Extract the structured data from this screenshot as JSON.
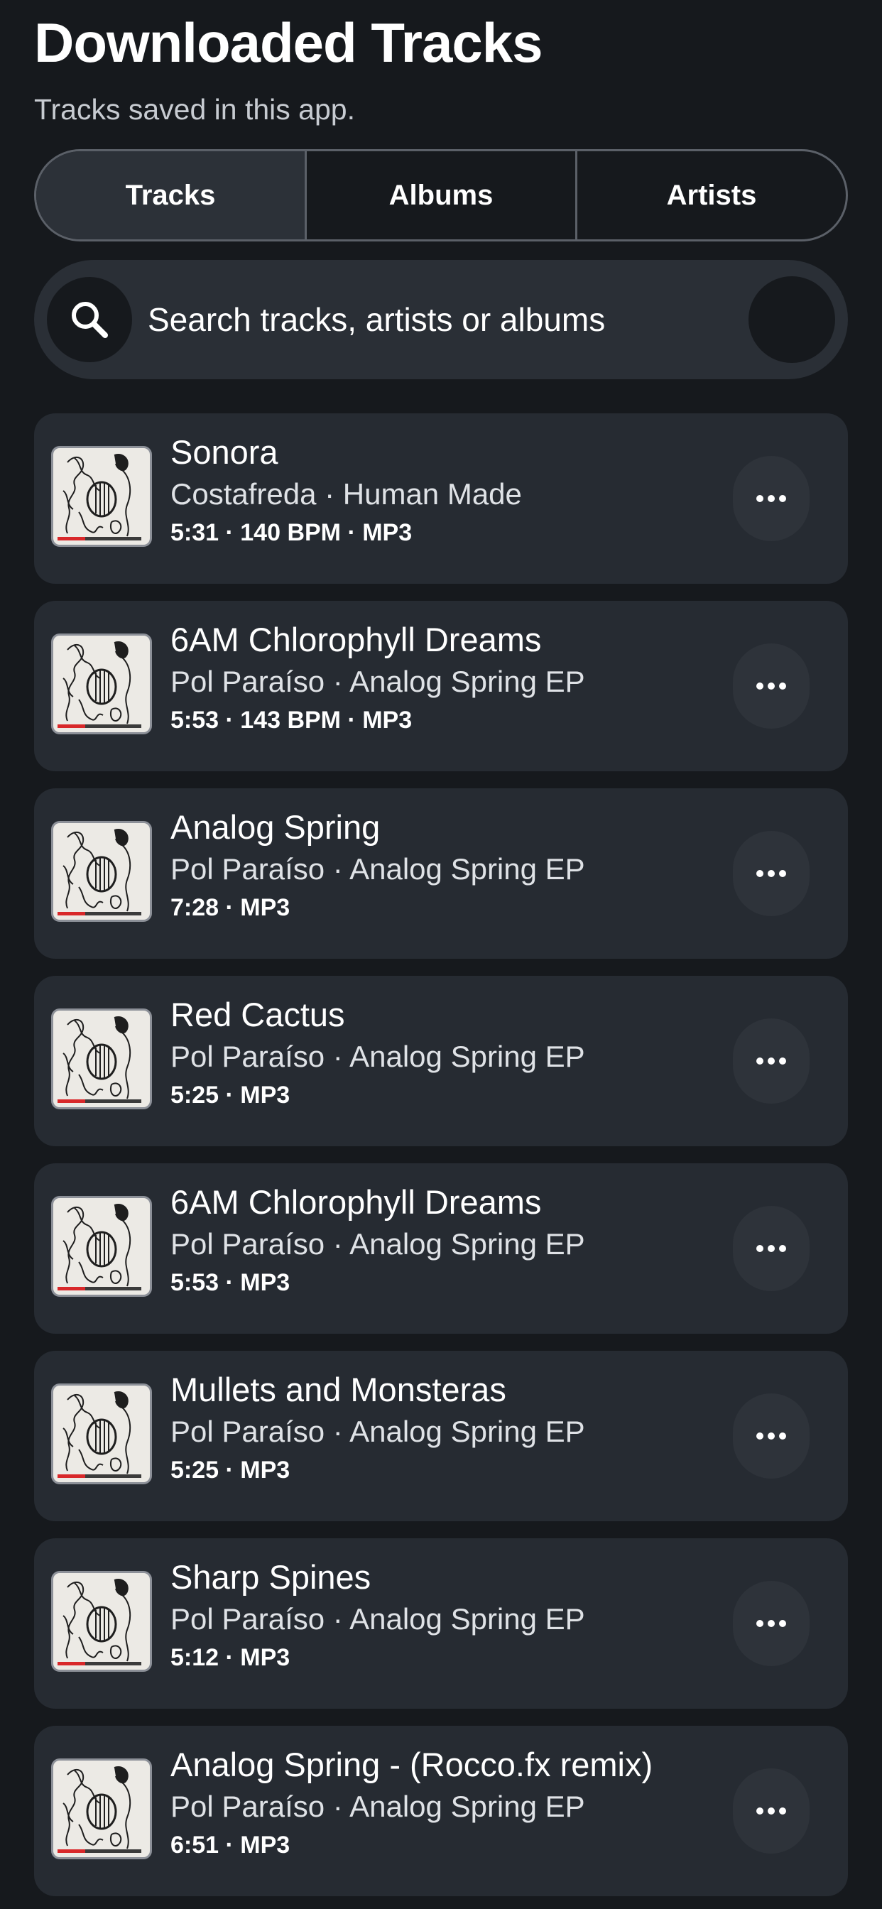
{
  "header": {
    "title": "Downloaded Tracks",
    "subtitle": "Tracks saved in this app."
  },
  "tabs": [
    {
      "label": "Tracks",
      "active": true
    },
    {
      "label": "Albums",
      "active": false
    },
    {
      "label": "Artists",
      "active": false
    }
  ],
  "search": {
    "placeholder": "Search tracks, artists or albums",
    "value": ""
  },
  "tracks": [
    {
      "title": "Sonora",
      "subtitle": "Costafreda · Human Made",
      "meta": "5:31 · 140 BPM · MP3",
      "progress": 0.33
    },
    {
      "title": "6AM Chlorophyll Dreams",
      "subtitle": "Pol Paraíso · Analog Spring EP",
      "meta": "5:53 · 143 BPM · MP3",
      "progress": 0.33
    },
    {
      "title": "Analog Spring",
      "subtitle": "Pol Paraíso · Analog Spring EP",
      "meta": "7:28 · MP3",
      "progress": 0.33
    },
    {
      "title": "Red Cactus",
      "subtitle": "Pol Paraíso · Analog Spring EP",
      "meta": "5:25 · MP3",
      "progress": 0.33
    },
    {
      "title": "6AM Chlorophyll Dreams",
      "subtitle": "Pol Paraíso · Analog Spring EP",
      "meta": "5:53 · MP3",
      "progress": 0.33
    },
    {
      "title": "Mullets and Monsteras",
      "subtitle": "Pol Paraíso · Analog Spring EP",
      "meta": "5:25 · MP3",
      "progress": 0.33
    },
    {
      "title": "Sharp Spines",
      "subtitle": "Pol Paraíso · Analog Spring EP",
      "meta": "5:12 · MP3",
      "progress": 0.33
    },
    {
      "title": "Analog Spring - (Rocco.fx remix)",
      "subtitle": "Pol Paraíso · Analog Spring EP",
      "meta": "6:51 · MP3",
      "progress": 0.33
    }
  ],
  "icons": {
    "search": "search-icon",
    "more": "more-horizontal-icon",
    "artwork": "album-artwork-icon"
  },
  "colors": {
    "background": "#16191d",
    "card": "#262b32",
    "progress": "#d8282a"
  }
}
